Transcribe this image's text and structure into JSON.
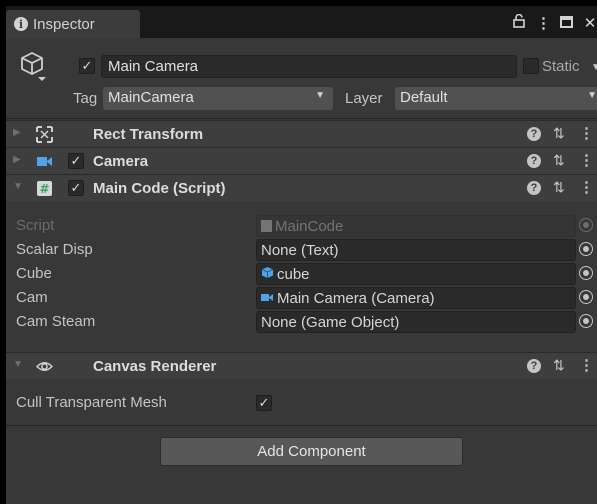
{
  "window": {
    "tab_title": "Inspector",
    "tab_icon": "info-icon",
    "tab_actions": [
      "lock-icon",
      "kebab-menu-icon",
      "maximize-icon",
      "close-icon"
    ]
  },
  "header": {
    "object_icon": "gameobject-cube-icon",
    "active_checked": true,
    "name": "Main Camera",
    "static_checked": false,
    "static_label": "Static",
    "tag_label": "Tag",
    "tag_value": "MainCamera",
    "layer_label": "Layer",
    "layer_value": "Default"
  },
  "components": [
    {
      "title": "Rect Transform",
      "icon": "rect-transform-icon",
      "has_checkbox": false,
      "expanded": false
    },
    {
      "title": "Camera",
      "icon": "camera-icon",
      "has_checkbox": true,
      "checked": true,
      "expanded": false
    },
    {
      "title": "Main Code (Script)",
      "icon": "script-icon",
      "has_checkbox": true,
      "checked": true,
      "expanded": true,
      "properties": [
        {
          "label": "Script",
          "value": "MainCode",
          "icon": "script-asset-icon",
          "disabled": true
        },
        {
          "label": "Scalar Disp",
          "value": "None (Text)",
          "icon": ""
        },
        {
          "label": "Cube",
          "value": "cube",
          "icon": "prefab-icon"
        },
        {
          "label": "Cam",
          "value": "Main Camera (Camera)",
          "icon": "camera-icon"
        },
        {
          "label": "Cam Steam",
          "value": "None (Game Object)",
          "icon": ""
        }
      ]
    },
    {
      "title": "Canvas Renderer",
      "icon": "eye-icon",
      "has_checkbox": false,
      "expanded": true,
      "properties": [
        {
          "label": "Cull Transparent Mesh",
          "checked": true
        }
      ]
    }
  ],
  "add_component_label": "Add Component",
  "colors": {
    "panel": "#383838",
    "field": "#2a2a2a",
    "accent_blue": "#4fa3e8",
    "script_green": "#3aa55a"
  }
}
